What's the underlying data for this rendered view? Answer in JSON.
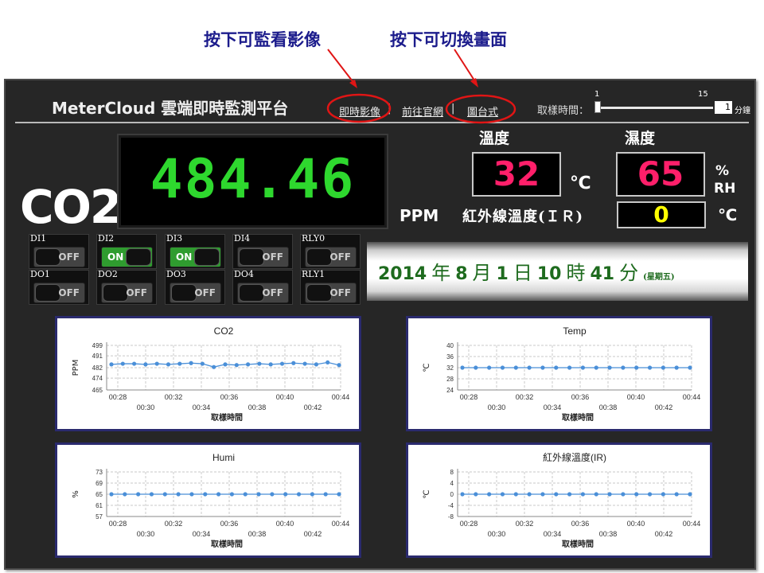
{
  "annotations": {
    "left": "按下可監看影像",
    "right": "按下可切換畫面"
  },
  "header": {
    "brand": "MeterCloud 雲端即時監測平台",
    "nav": [
      {
        "label": "即時影像"
      },
      {
        "label": "前往官網"
      },
      {
        "label": "圖台式"
      }
    ],
    "separator": "|",
    "sampling": {
      "label": "取樣時間：",
      "min": "1",
      "max": "15",
      "value": "1",
      "unit": "分鐘",
      "level": 0
    }
  },
  "co2": {
    "label": "CO2",
    "value": "484.46",
    "unit": "PPM",
    "color": "#2ed82e"
  },
  "temperature": {
    "title": "溫度",
    "value": "32",
    "unit": "℃",
    "color": "#ff1f6a"
  },
  "humidity": {
    "title": "濕度",
    "value": "65",
    "unit_top": "%",
    "unit_bottom": "RH",
    "color": "#ff1f6a"
  },
  "ir_temperature": {
    "title": "紅外線溫度(ＩＲ)",
    "value": "0",
    "unit": "℃",
    "color": "#ffff00"
  },
  "switches": [
    {
      "name": "DI1",
      "state": "OFF"
    },
    {
      "name": "DI2",
      "state": "ON"
    },
    {
      "name": "DI3",
      "state": "ON"
    },
    {
      "name": "DI4",
      "state": "OFF"
    },
    {
      "name": "RLY0",
      "state": "OFF"
    },
    {
      "name": "DO1",
      "state": "OFF"
    },
    {
      "name": "DO2",
      "state": "OFF"
    },
    {
      "name": "DO3",
      "state": "OFF"
    },
    {
      "name": "DO4",
      "state": "OFF"
    },
    {
      "name": "RLY1",
      "state": "OFF"
    }
  ],
  "datetime": {
    "year": "2014",
    "year_char": "年",
    "month": "8",
    "month_char": "月",
    "day": "1",
    "day_char": "日",
    "hour": "10",
    "hour_char": "時",
    "minute": "41",
    "minute_char": "分",
    "weekday": "(星期五)"
  },
  "chart_data": [
    {
      "type": "line",
      "title": "CO2",
      "xlabel": "取樣時間",
      "ylabel": "PPM",
      "ylim": [
        465,
        499
      ],
      "yticks": [
        465,
        474,
        482,
        491,
        499
      ],
      "xticks": [
        "00:28",
        "00:30",
        "00:32",
        "00:34",
        "00:36",
        "00:38",
        "00:40",
        "00:42",
        "00:44"
      ],
      "x": [
        "00:28",
        "00:29",
        "00:30",
        "00:31",
        "00:32",
        "00:33",
        "00:34",
        "00:35",
        "00:36",
        "00:37",
        "00:38",
        "00:39",
        "00:40",
        "00:41",
        "00:42",
        "00:43",
        "00:44",
        "00:45"
      ],
      "series": [
        {
          "values": [
            484.5,
            485,
            485,
            484.5,
            485,
            484.5,
            485,
            485.5,
            485,
            482.5,
            484.5,
            484,
            484.5,
            485,
            484.5,
            485,
            485.5,
            485,
            484.5,
            486,
            484
          ]
        }
      ],
      "color": "#4a8fd8",
      "grid": true
    },
    {
      "type": "line",
      "title": "Temp",
      "xlabel": "取樣時間",
      "ylabel": "℃",
      "ylim": [
        24,
        40
      ],
      "yticks": [
        24,
        28,
        32,
        36,
        40
      ],
      "xticks": [
        "00:28",
        "00:30",
        "00:32",
        "00:34",
        "00:36",
        "00:38",
        "00:40",
        "00:42",
        "00:44"
      ],
      "series": [
        {
          "values": [
            32,
            32,
            32,
            32,
            32,
            32,
            32,
            32,
            32,
            32,
            32,
            32,
            32,
            32,
            32,
            32,
            32,
            32
          ]
        }
      ],
      "color": "#4a8fd8",
      "grid": true
    },
    {
      "type": "line",
      "title": "Humi",
      "xlabel": "取樣時間",
      "ylabel": "%",
      "ylim": [
        57,
        73
      ],
      "yticks": [
        57,
        61,
        65,
        69,
        73
      ],
      "xticks": [
        "00:28",
        "00:30",
        "00:32",
        "00:34",
        "00:36",
        "00:38",
        "00:40",
        "00:42",
        "00:44"
      ],
      "series": [
        {
          "values": [
            65,
            65,
            65,
            65,
            65,
            65,
            65,
            65,
            65,
            65,
            65,
            65,
            65,
            65,
            65,
            65,
            65,
            65
          ]
        }
      ],
      "color": "#4a8fd8",
      "grid": true
    },
    {
      "type": "line",
      "title": "紅外線溫度(IR)",
      "xlabel": "取樣時間",
      "ylabel": "℃",
      "ylim": [
        -8,
        8
      ],
      "yticks": [
        -8,
        -4,
        0,
        4,
        8
      ],
      "xticks": [
        "00:28",
        "00:30",
        "00:32",
        "00:34",
        "00:36",
        "00:38",
        "00:40",
        "00:42",
        "00:44"
      ],
      "series": [
        {
          "values": [
            0,
            0,
            0,
            0,
            0,
            0,
            0,
            0,
            0,
            0,
            0,
            0,
            0,
            0,
            0,
            0,
            0,
            0
          ]
        }
      ],
      "color": "#4a8fd8",
      "grid": true
    }
  ]
}
